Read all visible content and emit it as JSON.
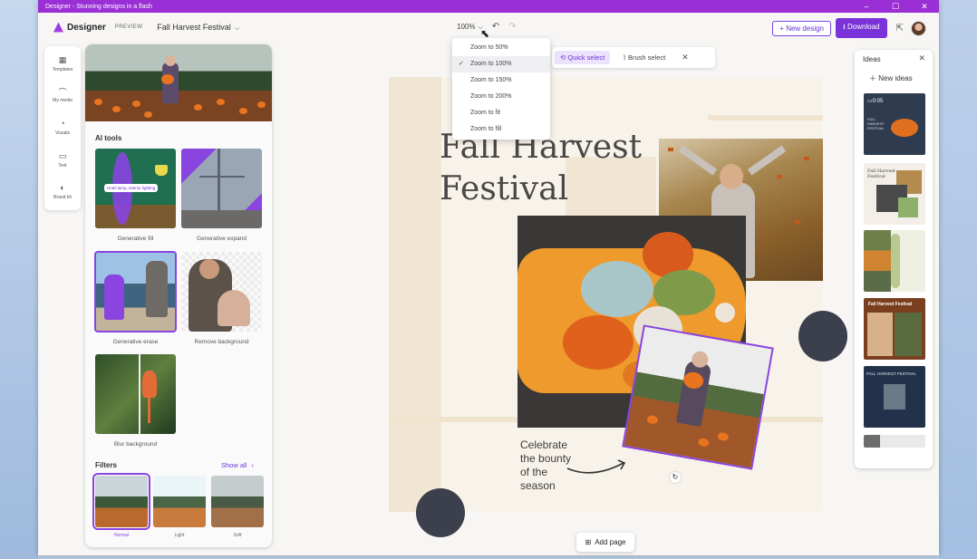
{
  "window": {
    "title": "Designer - Stunning designs in a flash"
  },
  "titlebar_controls": [
    "minimize-icon",
    "maximize-icon",
    "close-icon"
  ],
  "header": {
    "brand": "Designer",
    "preview_label": "PREVIEW",
    "doc_name": "Fall Harvest Festival",
    "zoom_value": "100%",
    "new_design_label": "+ New design",
    "download_label": "Download"
  },
  "zoom_menu": {
    "options": [
      "Zoom to 50%",
      "Zoom to 100%",
      "Zoom to 150%",
      "Zoom to 200%",
      "Zoom to fit",
      "Zoom to fill"
    ],
    "selected": "Zoom to 100%"
  },
  "rail": {
    "items": [
      {
        "label": "Templates",
        "icon": "templates-icon"
      },
      {
        "label": "My media",
        "icon": "media-icon"
      },
      {
        "label": "Visuals",
        "icon": "visuals-icon"
      },
      {
        "label": "Text",
        "icon": "text-icon"
      },
      {
        "label": "Brand kit",
        "icon": "brand-kit-icon"
      }
    ]
  },
  "panel": {
    "ai_tools_title": "AI tools",
    "tools": [
      {
        "label": "Generative fill",
        "tooltip": "Hotel lamp, interior lighting"
      },
      {
        "label": "Generative expand"
      },
      {
        "label": "Generative erase"
      },
      {
        "label": "Remove background"
      },
      {
        "label": "Blur background"
      }
    ],
    "filters_title": "Filters",
    "show_all": "Show all",
    "filters": [
      {
        "label": "Normal",
        "selected": true
      },
      {
        "label": "Light",
        "selected": false
      },
      {
        "label": "Soft",
        "selected": false
      }
    ]
  },
  "selection_toolbar": {
    "quick_select": "Quick select",
    "brush_select": "Brush select"
  },
  "canvas": {
    "title_line1": "Fall Harvest",
    "title_line2": "Festival",
    "caption_lines": [
      "Celebrate",
      "the bounty",
      "of the",
      "season"
    ]
  },
  "ideas": {
    "title": "Ideas",
    "new_ideas": "New ideas",
    "card1_time": "0:05",
    "card1_text": [
      "FALL",
      "HARVEST",
      "FESTIVAL"
    ],
    "card2_text": [
      "Fall Harvest",
      "Festival"
    ],
    "card4_title": "Fall Harvest Festival",
    "card5_title": "FALL HARVEST FESTIVAL"
  },
  "add_page": "Add page",
  "colors": {
    "accent": "#7a33d8",
    "titlebar": "#9b2fd6",
    "canvas_bg": "#f8f3ea",
    "title_text": "#4a4746"
  }
}
